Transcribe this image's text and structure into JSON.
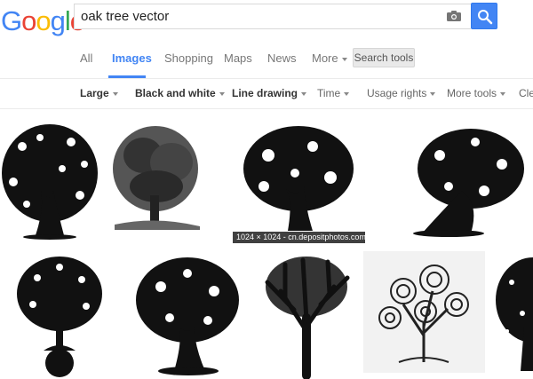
{
  "logo": {
    "letters": [
      "G",
      "o",
      "o",
      "g",
      "l",
      "e"
    ],
    "colors": [
      "#4285f4",
      "#ea4335",
      "#fbbc05",
      "#4285f4",
      "#34a853",
      "#ea4335"
    ]
  },
  "search": {
    "query": "oak tree vector",
    "accent": "#4285f4"
  },
  "tabs": [
    {
      "label": "All",
      "active": false
    },
    {
      "label": "Images",
      "active": true
    },
    {
      "label": "Shopping",
      "active": false
    },
    {
      "label": "Maps",
      "active": false
    },
    {
      "label": "News",
      "active": false
    },
    {
      "label": "More",
      "active": false
    }
  ],
  "search_tools_label": "Search tools",
  "filters": [
    {
      "label": "Large",
      "bold": true
    },
    {
      "label": "Black and white",
      "bold": true
    },
    {
      "label": "Line drawing",
      "bold": true
    },
    {
      "label": "Time",
      "bold": false
    },
    {
      "label": "Usage rights",
      "bold": false
    },
    {
      "label": "More tools",
      "bold": false
    },
    {
      "label": "Cle",
      "bold": false
    }
  ],
  "results": {
    "hover_caption": "1024 × 1024 - cn.depositphotos.com",
    "images": [
      "oak-tree-silhouette-with-leaves",
      "engraved-oak-tree-illustration",
      "oak-tree-silhouette-hovered",
      "curved-tree-silhouette",
      "acorn-oak-tree",
      "twisted-tree-silhouette",
      "bare-tree-silhouette",
      "swirl-tree-line-drawing",
      "partial-tree-silhouette"
    ]
  }
}
